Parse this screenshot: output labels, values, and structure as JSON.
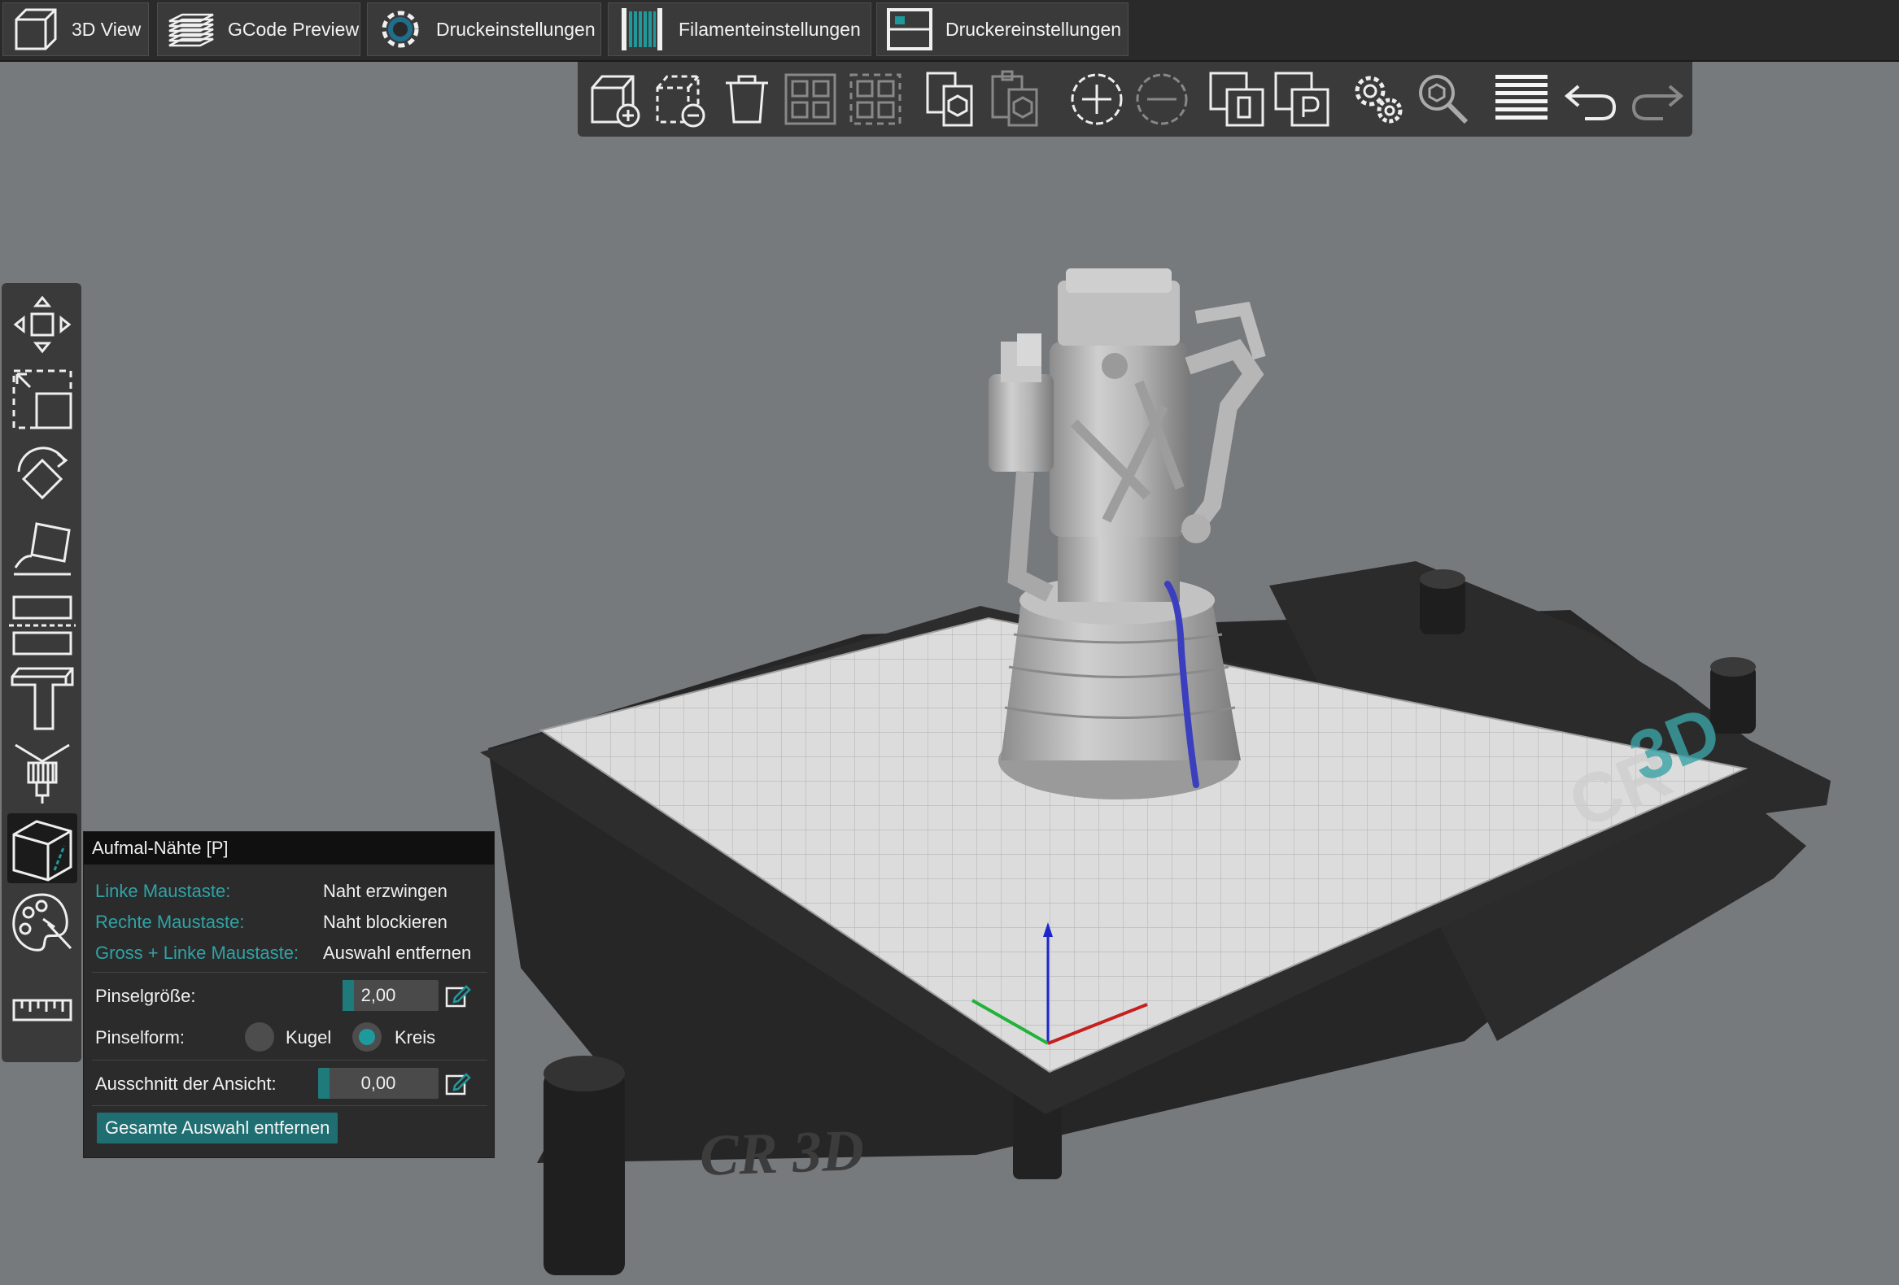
{
  "tabs": [
    {
      "label": "3D View",
      "icon": "cube-icon"
    },
    {
      "label": "GCode Preview",
      "icon": "layers-icon"
    },
    {
      "label": "Druckeinstellungen",
      "icon": "gear-icon"
    },
    {
      "label": "Filamenteinstellungen",
      "icon": "filament-spool-icon"
    },
    {
      "label": "Druckereinstellungen",
      "icon": "printer-icon"
    }
  ],
  "toolbar": [
    "add-object-icon",
    "remove-object-icon",
    "delete-all-icon",
    "arrange-icon",
    "arrange-selection-icon",
    "copy-icon",
    "paste-icon",
    "add-instance-icon",
    "remove-instance-icon",
    "split-to-objects-icon",
    "split-to-parts-icon",
    "settings-icon",
    "search-icon",
    "layer-editing-icon",
    "undo-icon",
    "redo-icon"
  ],
  "left_toolbar": [
    "move-icon",
    "scale-icon",
    "rotate-icon",
    "place-on-face-icon",
    "cut-icon",
    "support-painting-icon",
    "fdm-supports-icon",
    "seam-painting-icon",
    "multimaterial-painting-icon",
    "measure-icon"
  ],
  "panel": {
    "title": "Aufmal-Nähte [P]",
    "hints": [
      {
        "key": "Linke Maustaste:",
        "action": "Naht erzwingen"
      },
      {
        "key": "Rechte Maustaste:",
        "action": "Naht blockieren"
      },
      {
        "key": "Gross + Linke Maustaste:",
        "action": "Auswahl entfernen"
      }
    ],
    "brush_size": {
      "label": "Pinselgröße:",
      "value": "2,00",
      "fraction": 0.2
    },
    "brush_shape": {
      "label": "Pinselform:",
      "options": [
        "Kugel",
        "Kreis"
      ],
      "selected": "Kreis"
    },
    "clipping": {
      "label": "Ausschnitt der Ansicht:",
      "value": "0,00",
      "fraction": 0.0
    },
    "clear_button": "Gesamte Auswahl entfernen"
  },
  "bed_logo": "CR3D",
  "colors": {
    "accent": "#1e9a9d",
    "hint_key": "#2fa3a6",
    "seam": "#3b3fbf",
    "viewport_bg": "#777a7d"
  }
}
